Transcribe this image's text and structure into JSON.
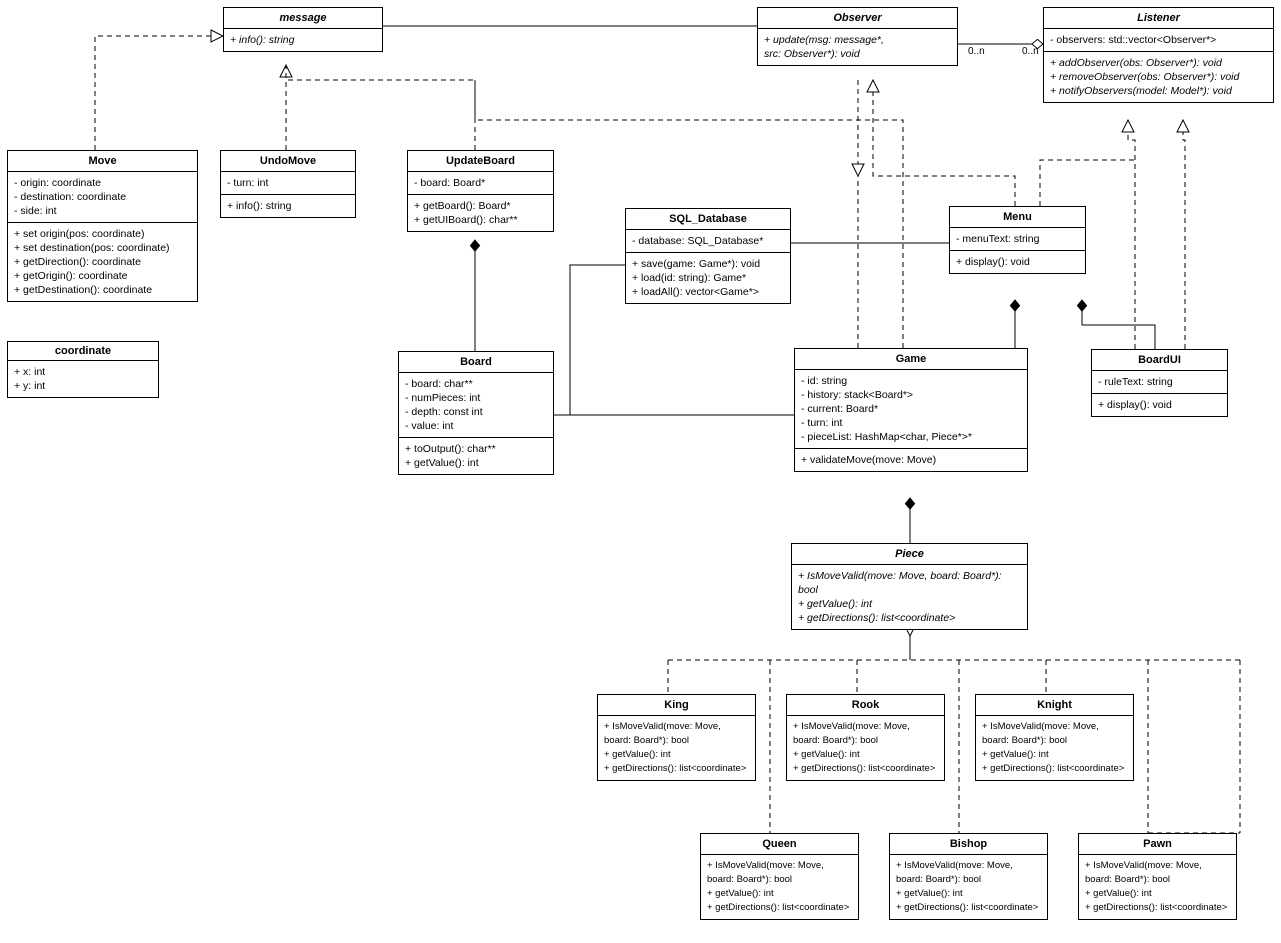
{
  "classes": {
    "message": {
      "title": "message",
      "methods": [
        "+ info(): string"
      ]
    },
    "Observer": {
      "title": "Observer",
      "methods": [
        "+ update(msg: message*,",
        "src: Observer*): void"
      ]
    },
    "Listener": {
      "title": "Listener",
      "attrs": [
        "- observers: std::vector<Observer*>"
      ],
      "methods": [
        "+ addObserver(obs: Observer*): void",
        "+ removeObserver(obs: Observer*): void",
        "+ notifyObservers(model: Model*): void"
      ]
    },
    "Move": {
      "title": "Move",
      "attrs": [
        "- origin: coordinate",
        "- destination: coordinate",
        "- side: int"
      ],
      "methods": [
        "+ set origin(pos: coordinate)",
        "+ set destination(pos: coordinate)",
        "+ getDirection(): coordinate",
        "+ getOrigin(): coordinate",
        "+ getDestination(): coordinate"
      ]
    },
    "UndoMove": {
      "title": "UndoMove",
      "attrs": [
        "- turn: int"
      ],
      "methods": [
        "+ info(): string"
      ]
    },
    "UpdateBoard": {
      "title": "UpdateBoard",
      "attrs": [
        "- board: Board*"
      ],
      "methods": [
        "+ getBoard(): Board*",
        "+ getUIBoard(): char**"
      ]
    },
    "SQL_Database": {
      "title": "SQL_Database",
      "attrs": [
        "- database: SQL_Database*"
      ],
      "methods": [
        "+ save(game: Game*): void",
        "+ load(id: string): Game*",
        "+ loadAll(): vector<Game*>"
      ]
    },
    "Menu": {
      "title": "Menu",
      "attrs": [
        "- menuText: string"
      ],
      "methods": [
        "+ display(): void"
      ]
    },
    "Board": {
      "title": "Board",
      "attrs": [
        "- board: char**",
        "- numPieces: int",
        "- depth: const int",
        "- value: int"
      ],
      "methods": [
        "+ toOutput(): char**",
        "+ getValue(): int"
      ]
    },
    "Game": {
      "title": "Game",
      "attrs": [
        "- id: string",
        "- history: stack<Board*>",
        "- current: Board*",
        "- turn: int",
        "- pieceList: HashMap<char, Piece*>*"
      ],
      "methods": [
        "+ validateMove(move: Move)"
      ]
    },
    "BoardUI": {
      "title": "BoardUI",
      "attrs": [
        "- ruleText: string"
      ],
      "methods": [
        "+ display(): void"
      ]
    },
    "Piece": {
      "title": "Piece",
      "methods": [
        "+ IsMoveValid(move: Move, board: Board*):",
        "bool",
        "+ getValue(): int",
        "+ getDirections(): list<coordinate>"
      ]
    },
    "King": {
      "title": "King",
      "methods": [
        "+ IsMoveValid(move: Move,",
        "board: Board*): bool",
        "+ getValue(): int",
        "+ getDirections(): list<coordinate>"
      ]
    },
    "Rook": {
      "title": "Rook",
      "methods": [
        "+ IsMoveValid(move: Move,",
        "board: Board*): bool",
        "+ getValue(): int",
        "+ getDirections(): list<coordinate>"
      ]
    },
    "Knight": {
      "title": "Knight",
      "methods": [
        "+ IsMoveValid(move: Move,",
        "board: Board*): bool",
        "+ getValue(): int",
        "+ getDirections(): list<coordinate>"
      ]
    },
    "Queen": {
      "title": "Queen",
      "methods": [
        "+ IsMoveValid(move: Move,",
        "board: Board*): bool",
        "+ getValue(): int",
        "+ getDirections(): list<coordinate>"
      ]
    },
    "Bishop": {
      "title": "Bishop",
      "methods": [
        "+ IsMoveValid(move: Move,",
        "board: Board*): bool",
        "+ getValue(): int",
        "+ getDirections(): list<coordinate>"
      ]
    },
    "Pawn": {
      "title": "Pawn",
      "methods": [
        "+ IsMoveValid(move: Move,",
        "board: Board*): bool",
        "+ getValue(): int",
        "+ getDirections(): list<coordinate>"
      ]
    },
    "coordinate": {
      "title": "coordinate",
      "methods": [
        "+ x: int",
        "+ y: int"
      ]
    }
  },
  "labels": {
    "obs_listener_left": "0..n",
    "obs_listener_right": "0..n"
  }
}
